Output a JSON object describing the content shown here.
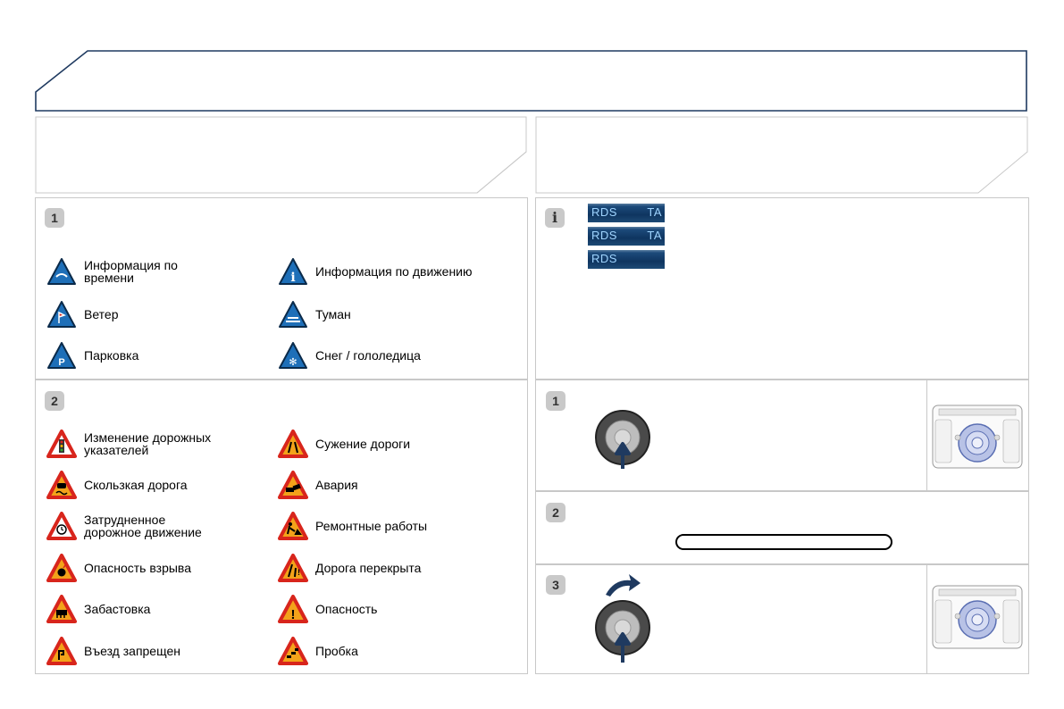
{
  "header": {
    "title": ""
  },
  "left_panel": {
    "group1": {
      "step": "1",
      "items": [
        {
          "label": "Информация по\nвремени",
          "icon": "weather-icon"
        },
        {
          "label": "Информация по движению",
          "icon": "info-icon"
        },
        {
          "label": "Ветер",
          "icon": "wind-icon"
        },
        {
          "label": "Туман",
          "icon": "fog-icon"
        },
        {
          "label": "Парковка",
          "icon": "parking-icon"
        },
        {
          "label": "Снег / гололедица",
          "icon": "snow-icon"
        }
      ]
    },
    "group2": {
      "step": "2",
      "items": [
        {
          "label": "Изменение дорожных\nуказателей",
          "icon": "traffic-light-icon"
        },
        {
          "label": "Сужение дороги",
          "icon": "road-narrows-icon"
        },
        {
          "label": "Скользкая дорога",
          "icon": "slippery-road-icon"
        },
        {
          "label": "Авария",
          "icon": "accident-icon"
        },
        {
          "label": "Затрудненное\nдорожное движение",
          "icon": "slow-traffic-icon"
        },
        {
          "label": "Ремонтные работы",
          "icon": "roadworks-icon"
        },
        {
          "label": "Опасность взрыва",
          "icon": "explosion-icon"
        },
        {
          "label": "Дорога перекрыта",
          "icon": "road-closed-icon"
        },
        {
          "label": "Забастовка",
          "icon": "strike-icon"
        },
        {
          "label": "Опасность",
          "icon": "danger-icon"
        },
        {
          "label": "Въезд запрещен",
          "icon": "no-entry-icon"
        },
        {
          "label": "Пробка",
          "icon": "traffic-jam-icon"
        }
      ]
    }
  },
  "right_panel": {
    "info": {
      "badges": [
        {
          "left": "RDS",
          "right": "TA"
        },
        {
          "left": "RDS",
          "right": "TA"
        },
        {
          "left": "RDS",
          "right": ""
        }
      ]
    },
    "steps": [
      "1",
      "2",
      "3"
    ]
  },
  "colors": {
    "frame": "#1f3a60",
    "blue_sign": "#1e6fb8",
    "red_sign": "#d8251c",
    "badge_text": "#9fd4ff"
  }
}
